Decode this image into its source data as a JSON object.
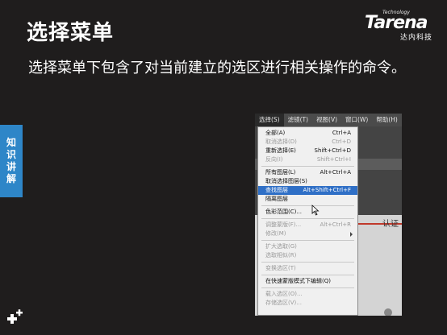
{
  "slide": {
    "title": "选择菜单",
    "subtitle": "选择菜单下包含了对当前建立的选区进行相关操作的命令。",
    "side_tab": [
      "知",
      "识",
      "讲",
      "解"
    ]
  },
  "logo": {
    "technology": "Technology",
    "brand": "Tarena",
    "brand_cn": "达内科技"
  },
  "menubar": [
    "选择(S)",
    "滤镜(T)",
    "视图(V)",
    "窗口(W)",
    "帮助(H)"
  ],
  "menu": {
    "items": [
      {
        "label": "全部(A)",
        "shortcut": "Ctrl+A"
      },
      {
        "label": "取消选择(D)",
        "shortcut": "Ctrl+D"
      },
      {
        "label": "重新选择(E)",
        "shortcut": "Shift+Ctrl+D"
      },
      {
        "label": "反向(I)",
        "shortcut": "Shift+Ctrl+I"
      },
      {
        "label": "所有图层(L)",
        "shortcut": "Alt+Ctrl+A"
      },
      {
        "label": "取消选择图层(S)",
        "shortcut": ""
      },
      {
        "label": "查找图层",
        "shortcut": "Alt+Shift+Ctrl+F"
      },
      {
        "label": "隔离图层",
        "shortcut": ""
      },
      {
        "label": "色彩范围(C)...",
        "shortcut": ""
      },
      {
        "label": "调整蒙版(F)...",
        "shortcut": "Alt+Ctrl+R"
      },
      {
        "label": "修改(M)",
        "shortcut": ""
      },
      {
        "label": "扩大选取(G)",
        "shortcut": ""
      },
      {
        "label": "选取相似(R)",
        "shortcut": ""
      },
      {
        "label": "变换选区(T)",
        "shortcut": ""
      },
      {
        "label": "在快速蒙版模式下编辑(Q)",
        "shortcut": ""
      },
      {
        "label": "载入选区(O)...",
        "shortcut": ""
      },
      {
        "label": "存储选区(V)...",
        "shortcut": ""
      }
    ]
  },
  "doc": {
    "text": "认证"
  },
  "colors": {
    "highlight": "#2f6fc6",
    "side_tab": "#2e86c8",
    "background": "#1f1d1d"
  }
}
